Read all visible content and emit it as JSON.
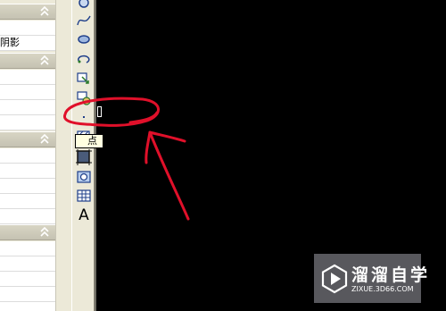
{
  "panel": {
    "groups": [
      {
        "rows": [
          "",
          "阴影"
        ]
      },
      {
        "rows": [
          "",
          "",
          "",
          ""
        ]
      },
      {
        "rows": [
          "",
          "",
          "",
          "",
          "",
          ""
        ]
      },
      {
        "rows": [
          "",
          "",
          "",
          "",
          ""
        ]
      }
    ]
  },
  "toolbar": {
    "tools": [
      "circle-icon",
      "spline-icon",
      "ellipse-icon",
      "ellipse-arc-icon",
      "insert-block-icon",
      "make-block-icon",
      "point-icon",
      "hatch-icon",
      "gradient-icon",
      "region-icon",
      "table-icon",
      "multiline-text-icon"
    ],
    "text_tool_label": "A"
  },
  "tooltip": {
    "label": "点"
  },
  "annotation": {
    "color": "#e0102a"
  },
  "watermark": {
    "title": "溜溜自学",
    "subtitle": "ZIXUE.3D66.COM"
  }
}
